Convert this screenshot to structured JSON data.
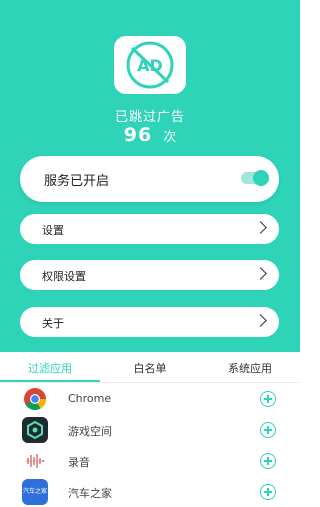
{
  "stats": {
    "label": "已跳过广告",
    "count": "96",
    "unit": "次"
  },
  "logo": {
    "text": "AD",
    "icon": "ad-block-icon"
  },
  "service": {
    "label": "服务已开启",
    "toggle_on": true
  },
  "menu": [
    {
      "label": "设置"
    },
    {
      "label": "权限设置"
    },
    {
      "label": "关于"
    }
  ],
  "tabs": [
    {
      "label": "过滤应用",
      "active": true
    },
    {
      "label": "白名单",
      "active": false
    },
    {
      "label": "系统应用",
      "active": false
    }
  ],
  "apps": [
    {
      "name": "Chrome",
      "icon": "chrome-icon"
    },
    {
      "name": "游戏空间",
      "icon": "game-space-icon"
    },
    {
      "name": "录音",
      "icon": "recorder-icon"
    },
    {
      "name": "汽车之家",
      "icon": "autohome-icon",
      "icon_text": "汽车之家"
    }
  ],
  "colors": {
    "accent": "#2ed3b8",
    "toggle_track": "#9fe7d9"
  }
}
